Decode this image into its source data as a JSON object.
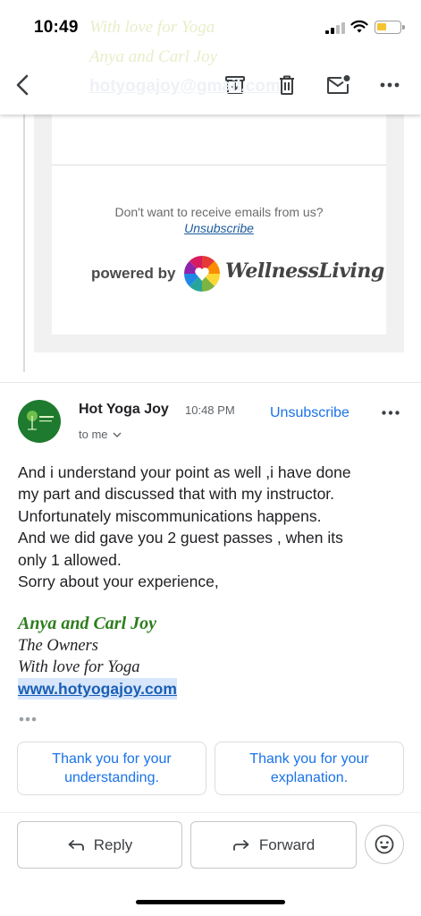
{
  "status_bar": {
    "time": "10:49"
  },
  "ghost_scrolled": {
    "line1": "With love for Yoga",
    "line2": "Anya and Carl Joy",
    "line3": "hotyogajoy@gmail.com"
  },
  "toolbar": {
    "back_icon": "arrow-back-icon",
    "archive_icon": "archive-icon",
    "delete_icon": "trash-icon",
    "mark_unread_icon": "mail-unread-icon",
    "more_icon": "more-horizontal-icon"
  },
  "quoted_email": {
    "unsubscribe_prompt": "Don't want to receive emails from us?",
    "unsubscribe_link": "Unsubscribe",
    "powered_by": "powered by",
    "brand": "WellnessLiving"
  },
  "message": {
    "sender": "Hot Yoga Joy",
    "time": "10:48 PM",
    "recipient": "to me",
    "unsubscribe": "Unsubscribe",
    "body_lines": [
      "And i understand your point as well ,i have done",
      "my part and discussed that with my instructor.",
      "Unfortunately miscommunications happens.",
      "And we did gave you 2 guest passes , when its",
      "only 1 allowed.",
      "Sorry about your experience,"
    ],
    "signature": {
      "name": "Anya and Carl Joy",
      "title": "The Owners",
      "tagline": "With love for Yoga",
      "website": "www.hotyogajoy.com"
    }
  },
  "smart_replies": [
    "Thank you for your understanding.",
    "Thank you for your explanation."
  ],
  "actions": {
    "reply": "Reply",
    "forward": "Forward",
    "emoji_icon": "emoji-smile-icon"
  },
  "colors": {
    "accent": "#1a73e8",
    "signature_green": "#2e7d1f",
    "avatar_green": "#1e7a2e"
  }
}
